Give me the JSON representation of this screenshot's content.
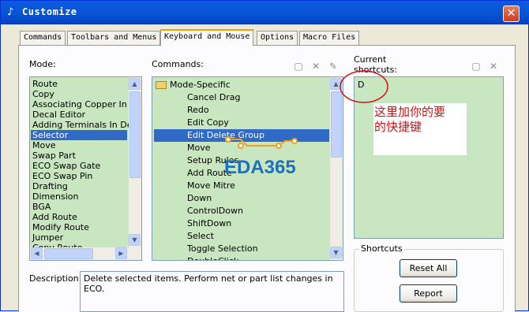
{
  "window": {
    "title": "Customize"
  },
  "tabs": [
    {
      "label": "Commands"
    },
    {
      "label": "Toolbars and Menus"
    },
    {
      "label": "Keyboard and Mouse"
    },
    {
      "label": "Options"
    },
    {
      "label": "Macro Files"
    }
  ],
  "mode": {
    "label": "Mode:",
    "items": [
      "Route",
      "Copy",
      "Associating Copper In De",
      "Decal Editor",
      "Adding Terminals In Deca",
      "Selector",
      "Move",
      "Swap Part",
      "ECO Swap Gate",
      "ECO Swap Pin",
      "Drafting",
      "Dimension",
      "BGA",
      "Add Route",
      "Modify Route",
      "Jumper",
      "Copy Route"
    ],
    "selected": "Selector"
  },
  "commands": {
    "label": "Commands:",
    "group": "Mode-Specific",
    "items": [
      "Cancel Drag",
      "Redo",
      "Edit Copy",
      "Edit Delete Group",
      "Move",
      "Setup Rules",
      "Add Route",
      "Move Mitre",
      "Down",
      "ControlDown",
      "ShiftDown",
      "Select",
      "Toggle Selection",
      "DoubleClick"
    ],
    "selected": "Edit Delete Group"
  },
  "current_shortcuts": {
    "label": "Current shortcuts:",
    "items": [
      "D"
    ]
  },
  "annotation": {
    "line1": "这里加你的要",
    "line2": "的快捷键"
  },
  "watermark": {
    "text": "EDA365"
  },
  "shortcuts_group": {
    "label": "Shortcuts",
    "reset_all_label": "Reset All",
    "report_label": "Report"
  },
  "description": {
    "label": "Description:",
    "text": "Delete selected items. Perform net or part list changes in ECO."
  },
  "colors": {
    "list_bg": "#c8e6c0",
    "selection": "#316ac5",
    "annotation": "#d01010",
    "watermark": "#1d6fc0"
  }
}
